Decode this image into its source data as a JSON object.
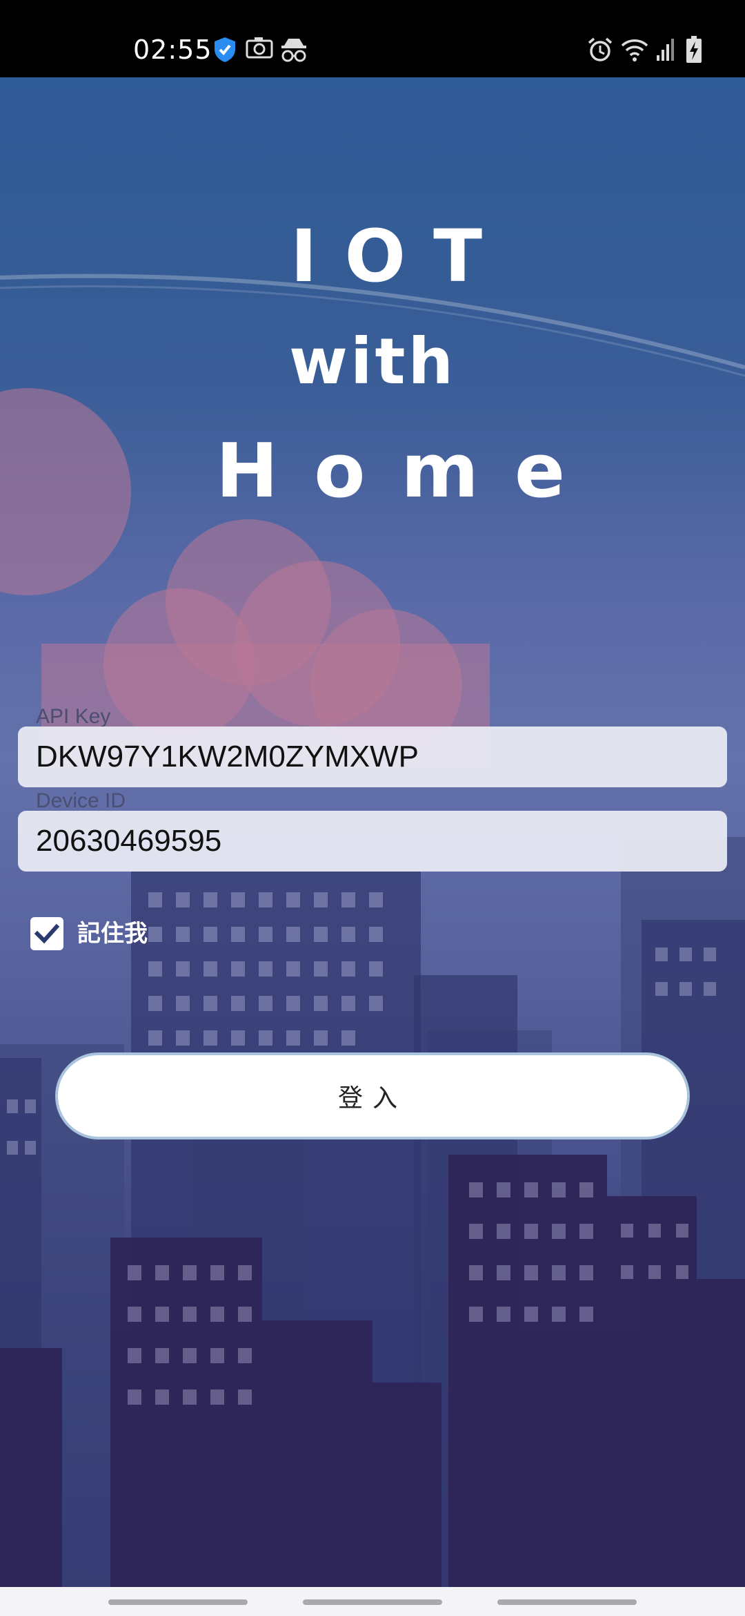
{
  "status_bar": {
    "time": "02:55",
    "left_icons": [
      "shield-check-icon",
      "camera-icon",
      "incognito-icon"
    ],
    "right_icons": [
      "alarm-icon",
      "wifi-icon",
      "signal-icon",
      "battery-charging-icon"
    ]
  },
  "title": {
    "line1": "IOT",
    "line2": "with",
    "line3": "Home"
  },
  "form": {
    "api_key_label": "API Key",
    "api_key_value": "DKW97Y1KW2M0ZYMXWP",
    "device_id_label": "Device ID",
    "device_id_value": "20630469595",
    "remember_label": "記住我",
    "remember_checked": true,
    "login_label": "登入"
  },
  "colors": {
    "accent_check": "#2b3a6e",
    "button_border": "#a9c4dc"
  }
}
